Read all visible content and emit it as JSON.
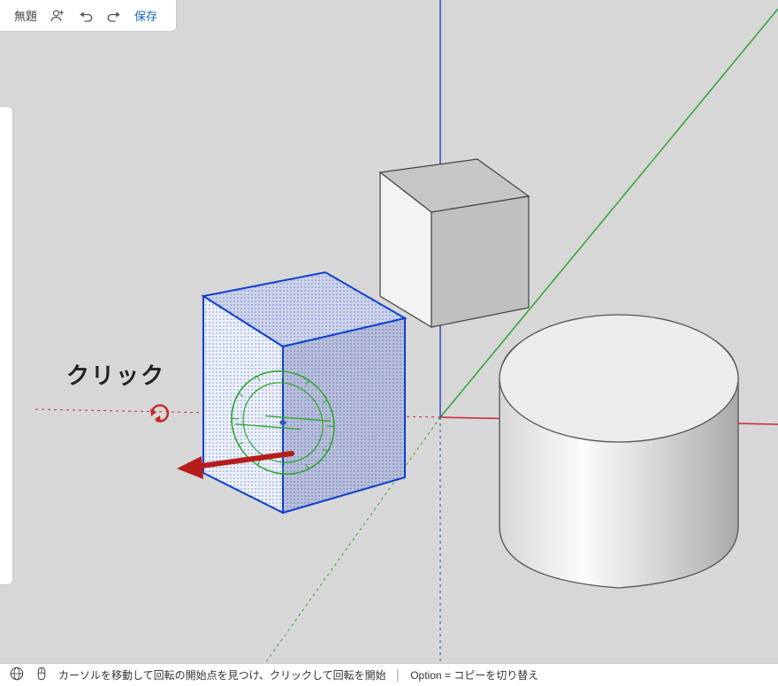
{
  "topbar": {
    "title": "無題",
    "save": "保存"
  },
  "annotation": {
    "click_label": "クリック"
  },
  "statusbar": {
    "hint": "カーソルを移動して回転の開始点を見つけ、クリックして回転を開始",
    "option_hint": "Option = コピーを切り替え"
  },
  "icons": {
    "user": "user-icon",
    "undo": "undo-icon",
    "redo": "redo-icon",
    "globe": "globe-icon",
    "mouse": "mouse-icon",
    "rotate_cursor": "rotate-icon"
  },
  "scene": {
    "axes": [
      "red",
      "green",
      "blue"
    ],
    "objects": [
      {
        "type": "cube",
        "selected": true,
        "has_protractor": true
      },
      {
        "type": "cube",
        "selected": false
      },
      {
        "type": "cylinder",
        "selected": false
      }
    ]
  }
}
